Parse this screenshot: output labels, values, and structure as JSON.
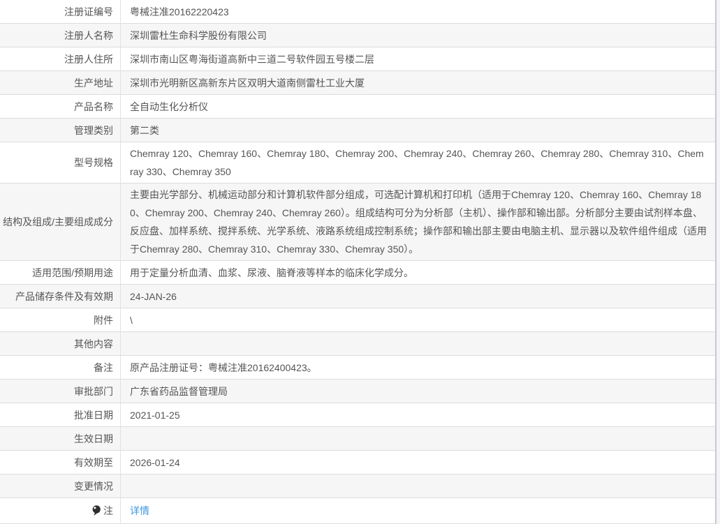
{
  "colors": {
    "link": "#3e97dd",
    "stripe": "#f6f6f6",
    "row_border": "#dcdcdc",
    "column_border": "#e2e2e2",
    "outer_right_border": "#c9c9d0",
    "text": "#555555"
  },
  "table": {
    "rows": [
      {
        "label": "注册证编号",
        "value": "粤械注准20162220423"
      },
      {
        "label": "注册人名称",
        "value": "深圳雷杜生命科学股份有限公司"
      },
      {
        "label": "注册人住所",
        "value": "深圳市南山区粤海街道高新中三道二号软件园五号楼二层"
      },
      {
        "label": "生产地址",
        "value": "深圳市光明新区高新东片区双明大道南侧雷杜工业大厦"
      },
      {
        "label": "产品名称",
        "value": "全自动生化分析仪"
      },
      {
        "label": "管理类别",
        "value": "第二类"
      },
      {
        "label": "型号规格",
        "value": "Chemray 120、Chemray 160、Chemray 180、Chemray 200、Chemray 240、Chemray 260、Chemray 280、Chemray 310、Chemray 330、Chemray 350"
      },
      {
        "label": "结构及组成/主要组成成分",
        "value": "主要由光学部分、机械运动部分和计算机软件部分组成，可选配计算机和打印机（适用于Chemray 120、Chemray 160、Chemray 180、Chemray 200、Chemray 240、Chemray 260）。组成结构可分为分析部（主机）、操作部和输出部。分析部分主要由试剂样本盘、反应盘、加样系统、搅拌系统、光学系统、液路系统组成控制系统；操作部和输出部主要由电脑主机、显示器以及软件组件组成（适用于Chemray 280、Chemray 310、Chemray 330、Chemray 350）。"
      },
      {
        "label": "适用范围/预期用途",
        "value": "用于定量分析血清、血浆、尿液、脑脊液等样本的临床化学成分。"
      },
      {
        "label": "产品储存条件及有效期",
        "value": "24-JAN-26"
      },
      {
        "label": "附件",
        "value": "\\"
      },
      {
        "label": "其他内容",
        "value": ""
      },
      {
        "label": "备注",
        "value": "原产品注册证号：粤械注准20162400423。"
      },
      {
        "label": "审批部门",
        "value": "广东省药品监督管理局"
      },
      {
        "label": "批准日期",
        "value": "2021-01-25"
      },
      {
        "label": "生效日期",
        "value": ""
      },
      {
        "label": "有效期至",
        "value": "2026-01-24"
      },
      {
        "label": "变更情况",
        "value": ""
      },
      {
        "label": "注",
        "value": "详情",
        "icon": "tip-icon"
      }
    ]
  }
}
